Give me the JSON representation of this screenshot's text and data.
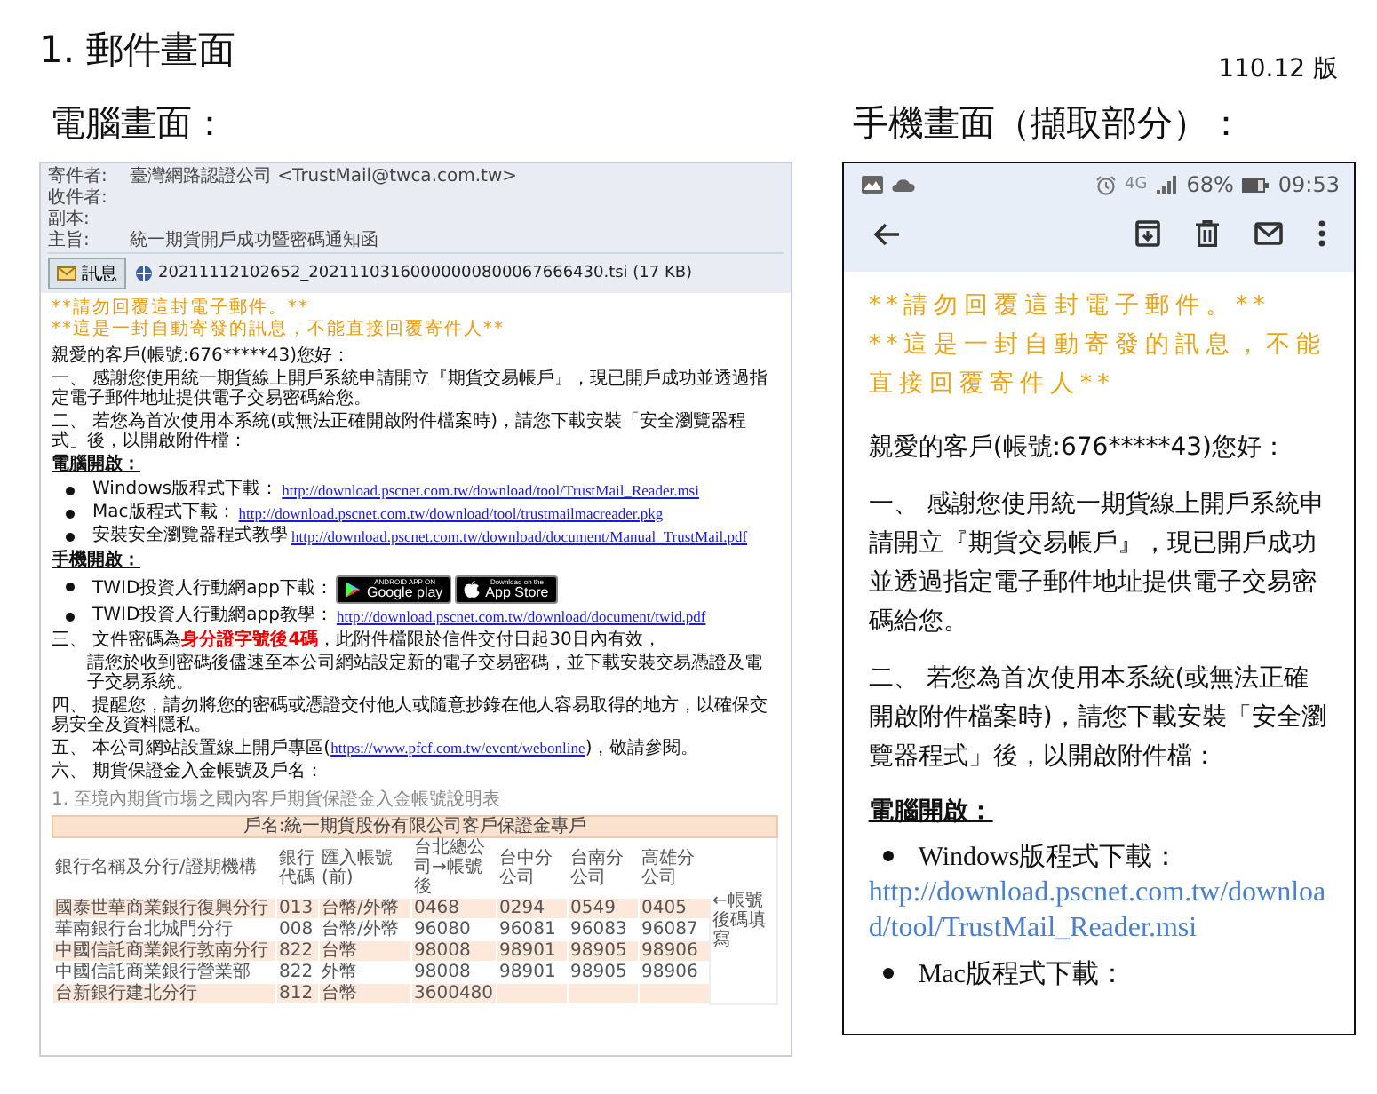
{
  "page": {
    "title": "1. 郵件畫面",
    "version": "110.12 版"
  },
  "desktop": {
    "heading": "電腦畫面：",
    "header_fields": [
      {
        "label": "寄件者:",
        "value": "臺灣網路認證公司 <TrustMail@twca.com.tw>"
      },
      {
        "label": "收件者:"
      },
      {
        "label": "副本:"
      },
      {
        "label": "主旨:",
        "value": "統一期貨開戶成功暨密碼通知函"
      }
    ],
    "message_button": "訊息",
    "attachment": "20211112102652_20211103160000000800067666430.tsi (17 KB)",
    "body": [
      {
        "kind": "notice",
        "text": "**請勿回覆這封電子郵件。**"
      },
      {
        "kind": "notice",
        "text": "**這是一封自動寄發的訊息，不能直接回覆寄件人**"
      },
      {
        "kind": "para",
        "text": "親愛的客戶(帳號:676*****43)您好："
      },
      {
        "kind": "para",
        "text": "一、 感謝您使用統一期貨線上開戶系統申請開立『期貨交易帳戶』，現已開戶成功並透過指定電子郵件地址提供電子交易密碼給您。"
      },
      {
        "kind": "para",
        "text": "二、 若您為首次使用本系統(或無法正確開啟附件檔案時)，請您下載安裝「安全瀏覽器程式」後，以開啟附件檔："
      },
      {
        "kind": "heading",
        "text": "電腦開啟："
      },
      {
        "kind": "bullet",
        "text": "Windows版程式下載：",
        "link": "http://download.pscnet.com.tw/download/tool/TrustMail_Reader.msi"
      },
      {
        "kind": "bullet",
        "text": "Mac版程式下載：",
        "link": "http://download.pscnet.com.tw/download/tool/trustmailmacreader.pkg"
      },
      {
        "kind": "bullet",
        "text": "安裝安全瀏覽器程式教學",
        "link": "http://download.pscnet.com.tw/download/document/Manual_TrustMail.pdf"
      },
      {
        "kind": "heading",
        "text": "手機開啟："
      },
      {
        "kind": "badges",
        "text": "TWID投資人行動網app下載：",
        "badges": [
          {
            "kind": "google",
            "small": "ANDROID APP ON",
            "big": "Google play"
          },
          {
            "kind": "apple",
            "small": "Download on the",
            "big": "App Store"
          }
        ]
      },
      {
        "kind": "bullet",
        "text": "TWID投資人行動網app教學：",
        "link": "http://download.pscnet.com.tw/download/document/twid.pdf"
      },
      {
        "kind": "richpara",
        "text": "三、 文件密碼為**身分證字號後4碼**，此附件檔限於信件交付日起30日內有效，"
      },
      {
        "kind": "indent",
        "text": "請您於收到密碼後儘速至本公司網站設定新的電子交易密碼，並下載安裝交易憑證及電子交易系統。"
      },
      {
        "kind": "para",
        "text": "四、 提醒您，請勿將您的密碼或憑證交付他人或隨意抄錄在他人容易取得的地方，以確保交易安全及資料隱私。"
      },
      {
        "kind": "linkpara",
        "text": "五、 本公司網站設置線上開戶專區(",
        "link": "https://www.pfcf.com.tw/event/webonline",
        "after": ")，敬請參閱。"
      },
      {
        "kind": "para",
        "text": "六、 期貨保證金入金帳號及戶名："
      },
      {
        "kind": "caption",
        "text": "1. 至境內期貨市場之國內客戶期貨保證金入金帳號說明表"
      }
    ],
    "table": {
      "title": "戶名:統一期貨股份有限公司客戶保證金專戶",
      "columns": [
        "銀行名稱及分行/證期機構",
        "銀行代碼",
        "匯入帳號(前)",
        "台北總公司→帳號後",
        "台中分公司",
        "台南分公司",
        "高雄分公司"
      ],
      "rows": [
        [
          "國泰世華商業銀行復興分行",
          "013",
          "台幣/外幣",
          "0468",
          "0294",
          "0549",
          "0405"
        ],
        [
          "華南銀行台北城門分行",
          "008",
          "台幣/外幣",
          "96080",
          "96081",
          "96083",
          "96087"
        ],
        [
          "中國信託商業銀行敦南分行",
          "822",
          "台幣",
          "98008",
          "98901",
          "98905",
          "98906"
        ],
        [
          "中國信託商業銀行營業部",
          "822",
          "外幣",
          "98008",
          "98901",
          "98905",
          "98906"
        ],
        [
          "台新銀行建北分行",
          "812",
          "台幣",
          "3600480",
          "",
          "",
          ""
        ]
      ],
      "note": "←帳號後碼填寫"
    }
  },
  "mobile": {
    "heading": "手機畫面（擷取部分）：",
    "status": {
      "network": "4G",
      "battery": "68%",
      "time": "09:53"
    },
    "body": [
      {
        "kind": "notice",
        "text": "**請勿回覆這封電子郵件。**"
      },
      {
        "kind": "notice",
        "text": "**這是一封自動寄發的訊息，不能直接回覆寄件人**"
      },
      {
        "kind": "para",
        "text": "親愛的客戶(帳號:676*****43)您好："
      },
      {
        "kind": "para",
        "text": "一、 感謝您使用統一期貨線上開戶系統申請開立『期貨交易帳戶』，現已開戶成功並透過指定電子郵件地址提供電子交易密碼給您。"
      },
      {
        "kind": "para",
        "text": "二、 若您為首次使用本系統(或無法正確開啟附件檔案時)，請您下載安裝「安全瀏覽器程式」後，以開啟附件檔："
      },
      {
        "kind": "heading",
        "text": "電腦開啟："
      },
      {
        "kind": "bullet",
        "text": "Windows版程式下載：",
        "link": "http://download.pscnet.com.tw/download/tool/TrustMail_Reader.msi"
      },
      {
        "kind": "bullet",
        "text": "Mac版程式下載："
      }
    ]
  }
}
